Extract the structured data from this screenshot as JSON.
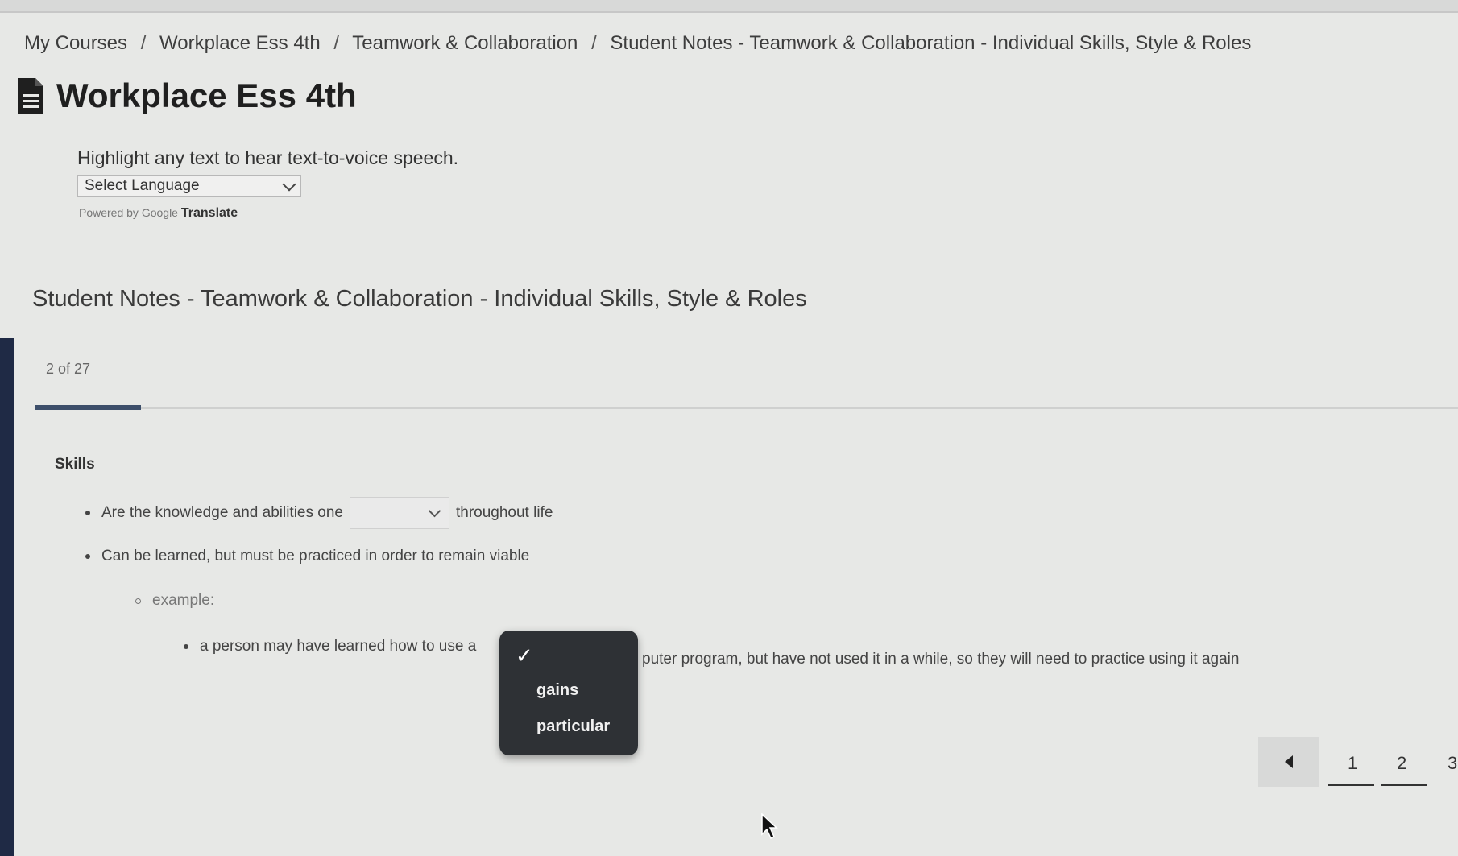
{
  "breadcrumb": {
    "items": [
      "My Courses",
      "Workplace Ess 4th",
      "Teamwork & Collaboration",
      "Student Notes - Teamwork & Collaboration - Individual Skills, Style & Roles"
    ],
    "separator": "/"
  },
  "page_title": "Workplace Ess 4th",
  "tts_hint": "Highlight any text to hear text-to-voice speech.",
  "translate": {
    "select_placeholder": "Select Language",
    "powered_by": "Powered by",
    "google": "Google",
    "translate": "Translate"
  },
  "lesson": {
    "title": "Student Notes - Teamwork & Collaboration - Individual Skills, Style & Roles",
    "page_count": "2 of 27",
    "progress_fraction": 0.074
  },
  "notes": {
    "heading": "Skills",
    "bullet1_pre": "Are the knowledge and abilities one",
    "bullet1_post": "throughout life",
    "bullet2": "Can be learned, but must be practiced in order to remain viable",
    "sub_bullet": "example:",
    "sub_sub_pre": "a person may have learned how to use a",
    "sub_sub_post": "puter program, but have not used it in a while, so they will need to practice using it again"
  },
  "dropdown_popup": {
    "check": "✓",
    "options": [
      "gains",
      "particular"
    ]
  },
  "pagination": {
    "pages": [
      "1",
      "2",
      "3"
    ],
    "current": "2"
  },
  "icons": {
    "title_icon": "document-icon",
    "prev_icon": "caret-left-icon",
    "chevron": "chevron-down-icon",
    "cursor": "mouse-cursor-icon"
  },
  "colors": {
    "background": "#e7e8e6",
    "progress": "#3d4f6a",
    "popup": "#2e3135"
  }
}
